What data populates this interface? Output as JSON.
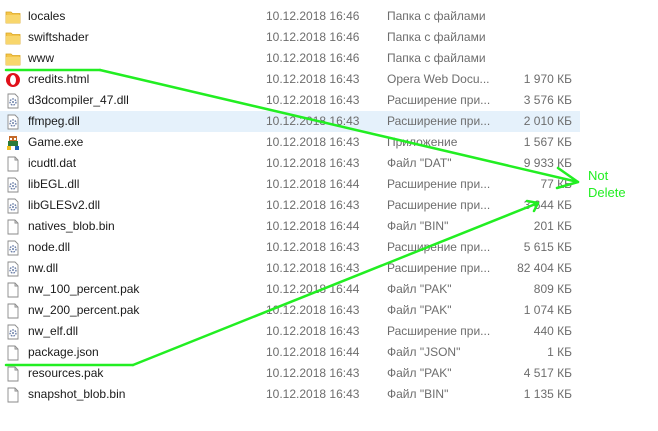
{
  "files": [
    {
      "name": "locales",
      "date": "10.12.2018 16:46",
      "type": "Папка с файлами",
      "size": "",
      "icon": "folder-icon"
    },
    {
      "name": "swiftshader",
      "date": "10.12.2018 16:46",
      "type": "Папка с файлами",
      "size": "",
      "icon": "folder-icon"
    },
    {
      "name": "www",
      "date": "10.12.2018 16:46",
      "type": "Папка с файлами",
      "size": "",
      "icon": "folder-icon"
    },
    {
      "name": "credits.html",
      "date": "10.12.2018 16:43",
      "type": "Opera Web Docu...",
      "size": "1 970 КБ",
      "icon": "opera-icon"
    },
    {
      "name": "d3dcompiler_47.dll",
      "date": "10.12.2018 16:43",
      "type": "Расширение при...",
      "size": "3 576 КБ",
      "icon": "dll-icon"
    },
    {
      "name": "ffmpeg.dll",
      "date": "10.12.2018 16:43",
      "type": "Расширение при...",
      "size": "2 010 КБ",
      "icon": "dll-icon"
    },
    {
      "name": "Game.exe",
      "date": "10.12.2018 16:43",
      "type": "Приложение",
      "size": "1 567 КБ",
      "icon": "game-exe-icon"
    },
    {
      "name": "icudtl.dat",
      "date": "10.12.2018 16:43",
      "type": "Файл \"DAT\"",
      "size": "9 933 КБ",
      "icon": "file-icon"
    },
    {
      "name": "libEGL.dll",
      "date": "10.12.2018 16:44",
      "type": "Расширение при...",
      "size": "77 КБ",
      "icon": "dll-icon"
    },
    {
      "name": "libGLESv2.dll",
      "date": "10.12.2018 16:43",
      "type": "Расширение при...",
      "size": "3 644 КБ",
      "icon": "dll-icon"
    },
    {
      "name": "natives_blob.bin",
      "date": "10.12.2018 16:44",
      "type": "Файл \"BIN\"",
      "size": "201 КБ",
      "icon": "file-icon"
    },
    {
      "name": "node.dll",
      "date": "10.12.2018 16:43",
      "type": "Расширение при...",
      "size": "5 615 КБ",
      "icon": "dll-icon"
    },
    {
      "name": "nw.dll",
      "date": "10.12.2018 16:43",
      "type": "Расширение при...",
      "size": "82 404 КБ",
      "icon": "dll-icon"
    },
    {
      "name": "nw_100_percent.pak",
      "date": "10.12.2018 16:44",
      "type": "Файл \"PAK\"",
      "size": "809 КБ",
      "icon": "file-icon"
    },
    {
      "name": "nw_200_percent.pak",
      "date": "10.12.2018 16:43",
      "type": "Файл \"PAK\"",
      "size": "1 074 КБ",
      "icon": "file-icon"
    },
    {
      "name": "nw_elf.dll",
      "date": "10.12.2018 16:43",
      "type": "Расширение при...",
      "size": "440 КБ",
      "icon": "dll-icon"
    },
    {
      "name": "package.json",
      "date": "10.12.2018 16:44",
      "type": "Файл \"JSON\"",
      "size": "1 КБ",
      "icon": "file-icon"
    },
    {
      "name": "resources.pak",
      "date": "10.12.2018 16:43",
      "type": "Файл \"PAK\"",
      "size": "4 517 КБ",
      "icon": "file-icon"
    },
    {
      "name": "snapshot_blob.bin",
      "date": "10.12.2018 16:43",
      "type": "Файл \"BIN\"",
      "size": "1 135 КБ",
      "icon": "file-icon"
    }
  ],
  "selected_row": "ffmpeg.dll",
  "annotation": {
    "line1": "Not",
    "line2": "Delete",
    "color": "#22ee22"
  },
  "colors": {
    "selection": "#e5f1fb",
    "secondary_text": "#6d6d6d",
    "folder": "#f4c54a"
  }
}
